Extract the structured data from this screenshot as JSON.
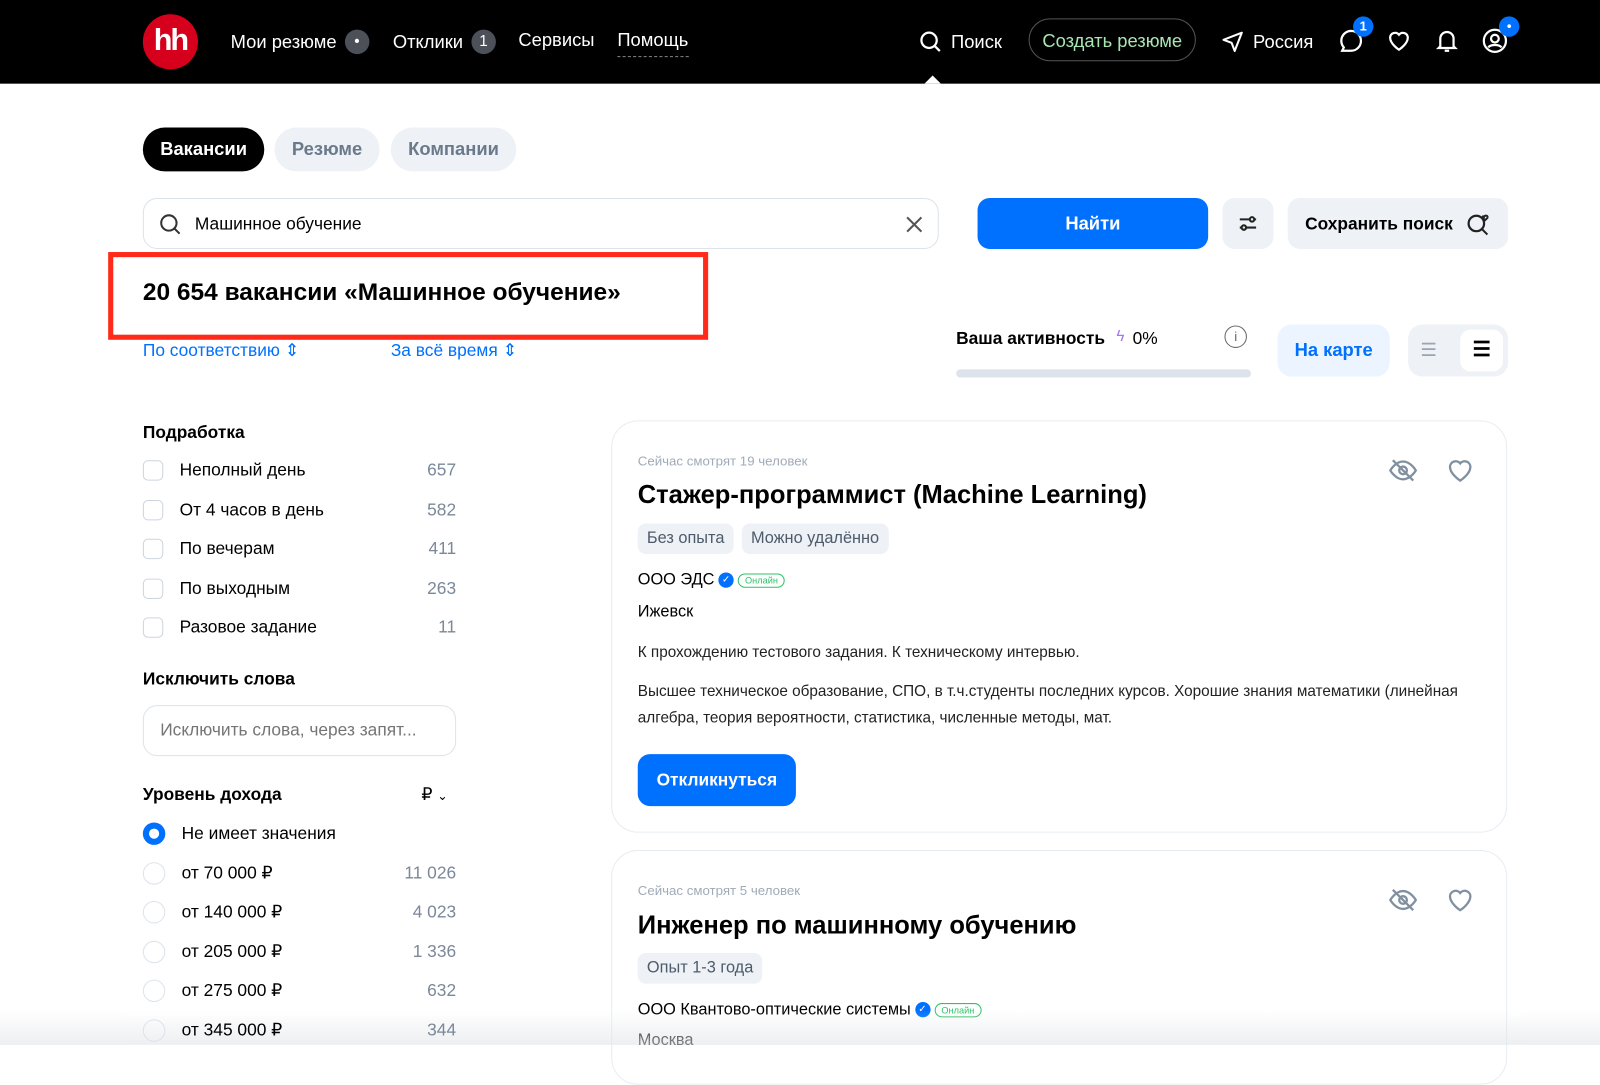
{
  "header": {
    "logo": "hh",
    "nav": [
      {
        "label": "Мои резюме",
        "badge": "•"
      },
      {
        "label": "Отклики",
        "badge": "1"
      },
      {
        "label": "Сервисы"
      },
      {
        "label": "Помощь"
      }
    ],
    "search_label": "Поиск",
    "create_resume": "Создать резюме",
    "region": "Россия",
    "messages_badge": "1",
    "profile_badge": "•"
  },
  "tabs": [
    "Вакансии",
    "Резюме",
    "Компании"
  ],
  "search": {
    "value": "Машинное обучение",
    "find": "Найти",
    "save": "Сохранить поиск"
  },
  "results": {
    "title": "20 654 вакансии «Машинное обучение»",
    "sort": "По соответствию",
    "period": "За всё время"
  },
  "activity": {
    "label": "Ваша активность",
    "value": "0%",
    "progress_percent": 0,
    "map": "На карте"
  },
  "filters": {
    "parttime": {
      "title": "Подработка",
      "items": [
        {
          "label": "Неполный день",
          "count": "657"
        },
        {
          "label": "От 4 часов в день",
          "count": "582"
        },
        {
          "label": "По вечерам",
          "count": "411"
        },
        {
          "label": "По выходным",
          "count": "263"
        },
        {
          "label": "Разовое задание",
          "count": "11"
        }
      ]
    },
    "exclude": {
      "title": "Исключить слова",
      "placeholder": "Исключить слова, через запят..."
    },
    "income": {
      "title": "Уровень дохода",
      "currency": "₽",
      "items": [
        {
          "label": "Не имеет значения",
          "count": "",
          "selected": true
        },
        {
          "label": "от 70 000 ₽",
          "count": "11 026"
        },
        {
          "label": "от 140 000 ₽",
          "count": "4 023"
        },
        {
          "label": "от 205 000 ₽",
          "count": "1 336"
        },
        {
          "label": "от 275 000 ₽",
          "count": "632"
        },
        {
          "label": "от 345 000 ₽",
          "count": "344"
        }
      ]
    }
  },
  "vacancies": [
    {
      "viewers": "Сейчас смотрят 19 человек",
      "title": "Стажер-программист (Machine Learning)",
      "tags": [
        "Без опыта",
        "Можно удалённо"
      ],
      "company": "ООО ЭДС",
      "online": "Онлайн",
      "city": "Ижевск",
      "desc1": "К прохождению тестового задания. К техническому интервью.",
      "desc2": "Высшее техническое образование, СПО, в т.ч.студенты последних курсов. Хорошие знания математики (линейная алгебра, теория вероятности, статистика, численные методы, мат.",
      "apply": "Откликнуться"
    },
    {
      "viewers": "Сейчас смотрят 5 человек",
      "title": "Инженер по машинному обучению",
      "tags": [
        "Опыт 1-3 года"
      ],
      "company": "ООО Квантово-оптические системы",
      "online": "Онлайн",
      "city": "Москва"
    }
  ],
  "colors": {
    "accent": "#0070ff",
    "brand": "#d6001c",
    "highlight": "#ff2a1a"
  }
}
